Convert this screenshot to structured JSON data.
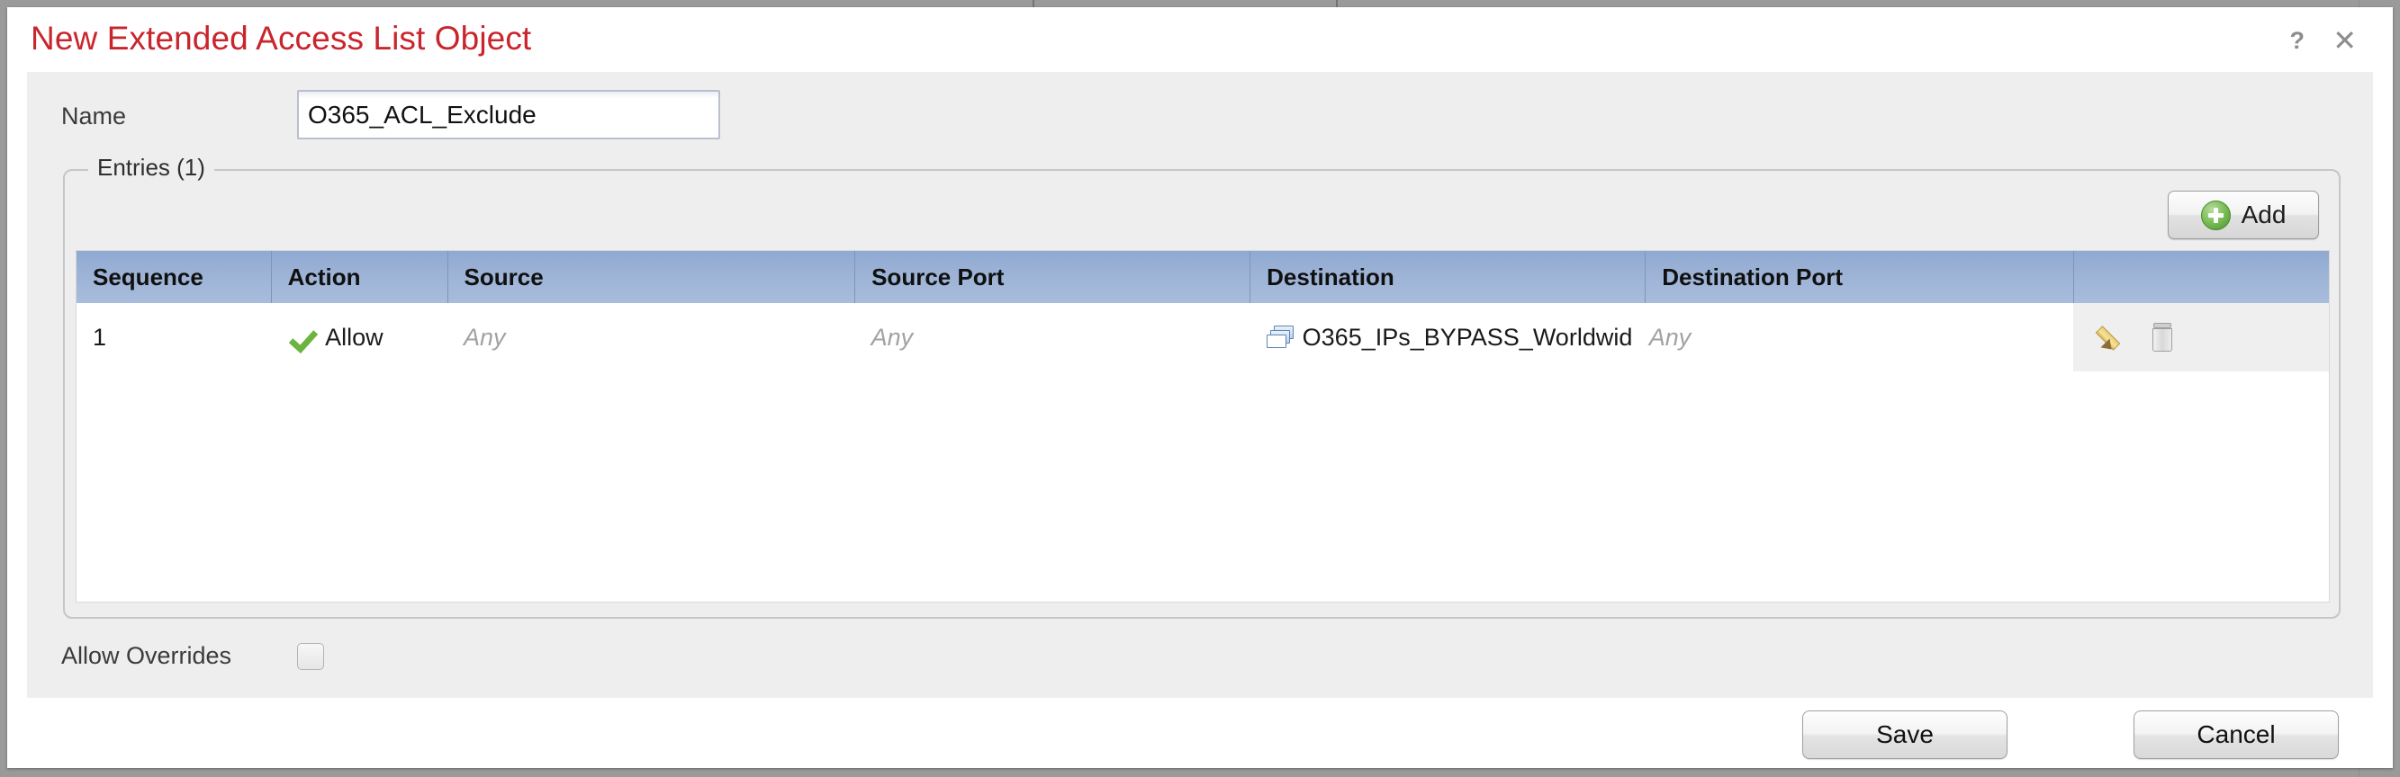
{
  "dialog": {
    "title": "New Extended Access List Object",
    "help_icon": "question-mark-icon",
    "close_icon": "close-icon"
  },
  "form": {
    "name_label": "Name",
    "name_value": "O365_ACL_Exclude",
    "allow_overrides_label": "Allow Overrides",
    "allow_overrides_checked": false
  },
  "entries": {
    "legend": "Entries (1)",
    "add_label": "Add",
    "add_icon": "green-plus-icon",
    "columns": [
      "Sequence",
      "Action",
      "Source",
      "Source Port",
      "Destination",
      "Destination Port",
      ""
    ],
    "rows": [
      {
        "sequence": "1",
        "action": "Allow",
        "action_icon": "green-check-icon",
        "source": "Any",
        "source_port": "Any",
        "destination": "O365_IPs_BYPASS_Worldwid",
        "destination_icon": "object-group-icon",
        "destination_port": "Any",
        "edit_icon": "pencil-icon",
        "delete_icon": "trash-icon"
      }
    ]
  },
  "footer": {
    "save_label": "Save",
    "cancel_label": "Cancel"
  },
  "colors": {
    "title_red": "#c9252d",
    "header_blue": "#9db3d6",
    "allow_green": "#6db33f",
    "panel_gray": "#eeeeee",
    "backdrop_gray": "#9a9a9a"
  }
}
